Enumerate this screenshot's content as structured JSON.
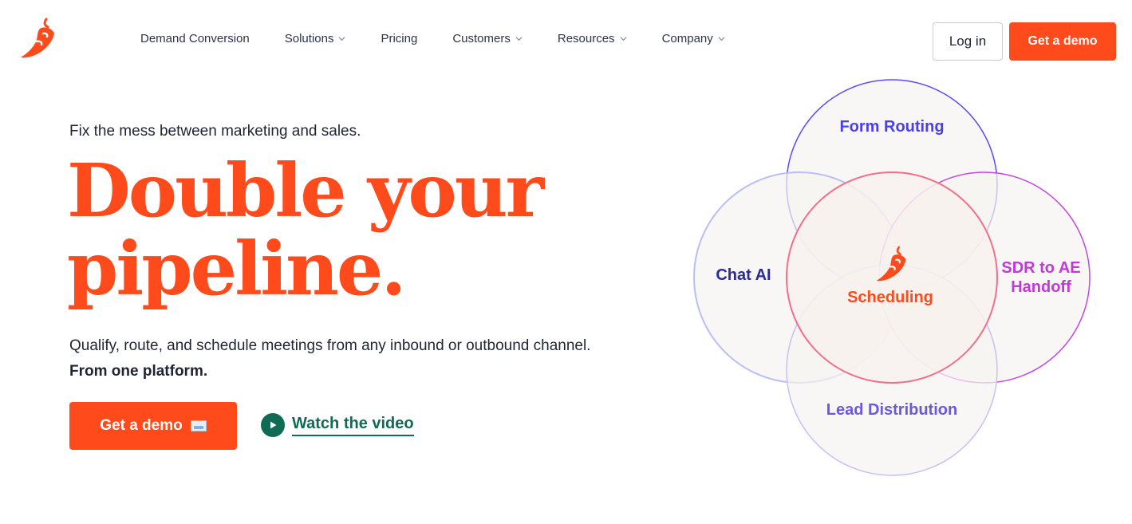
{
  "brand": {
    "accent": "#ff4a1c",
    "text": "#1f2433",
    "video_green": "#0f6b55",
    "logo_icon": "chili-pepper-icon"
  },
  "nav": {
    "items": [
      {
        "label": "Demand Conversion",
        "has_dropdown": false
      },
      {
        "label": "Solutions",
        "has_dropdown": true
      },
      {
        "label": "Pricing",
        "has_dropdown": false
      },
      {
        "label": "Customers",
        "has_dropdown": true
      },
      {
        "label": "Resources",
        "has_dropdown": true
      },
      {
        "label": "Company",
        "has_dropdown": true
      }
    ],
    "login_label": "Log in",
    "demo_label": "Get a demo"
  },
  "hero": {
    "eyebrow": "Fix the mess between marketing and sales.",
    "headline_line1": "Double your",
    "headline_line2": "pipeline.",
    "sub_text": "Qualify, route, and schedule meetings from any inbound or outbound channel.",
    "sub_bold": "From one platform.",
    "cta_label": "Get a demo",
    "video_label": "Watch the video"
  },
  "diagram": {
    "form_routing": "Form Routing",
    "chat_ai": "Chat AI",
    "sdr_line1": "SDR to AE",
    "sdr_line2": "Handoff",
    "lead_distribution": "Lead Distribution",
    "scheduling": "Scheduling",
    "colors": {
      "form_routing": "#4a3ff0",
      "chat_ai": "#2b2a9a",
      "sdr": "#c03ad6",
      "lead": "#6b58e0",
      "scheduling": "#ff4a1c"
    }
  }
}
